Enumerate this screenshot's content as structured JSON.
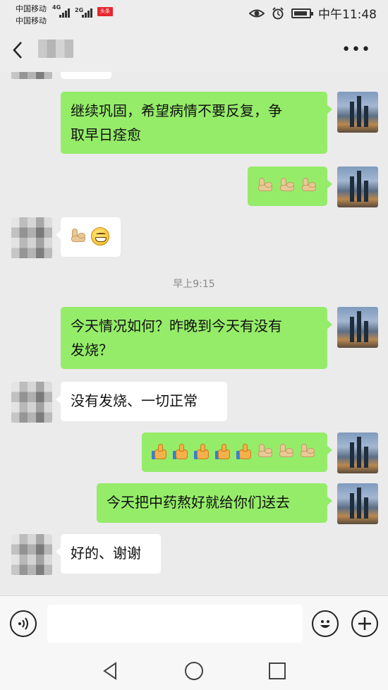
{
  "status_bar": {
    "carrier_1": "中国移动",
    "carrier_2": "中国移动",
    "network_1": "4G",
    "network_2": "2G",
    "news_badge": "头条",
    "time": "中午11:48",
    "battery_level": 0.9
  },
  "header": {
    "contact_name": "",
    "back_icon": "chevron-left-icon",
    "more_icon": "more-dots-icon"
  },
  "messages": [
    {
      "side": "out",
      "text": "继续巩固，希望病情不要反复，争取早日痊愈"
    },
    {
      "side": "out",
      "emoji": [
        "muscle",
        "muscle",
        "muscle"
      ]
    },
    {
      "side": "in",
      "emoji": [
        "muscle",
        "grin"
      ]
    },
    {
      "side": "out",
      "text": "今天情况如何？昨晚到今天有没有发烧？"
    },
    {
      "side": "in",
      "text": "没有发烧、一切正常"
    },
    {
      "side": "out",
      "emoji": [
        "thumbs-up",
        "thumbs-up",
        "thumbs-up",
        "thumbs-up",
        "thumbs-up",
        "muscle",
        "muscle",
        "muscle"
      ]
    },
    {
      "side": "out",
      "text": "今天把中药熬好就给你们送去"
    },
    {
      "side": "in",
      "text": "好的、谢谢"
    }
  ],
  "timestamp": "早上9:15",
  "msg_text": {
    "m0_line1": "继续巩固，希望病情不要反复，争",
    "m0_line2": "取早日痊愈",
    "m3_line1": "今天情况如何？昨晚到今天有没有",
    "m3_line2": "发烧？",
    "m4": "没有发烧、一切正常",
    "m6": "今天把中药熬好就给你们送去",
    "m7": "好的、谢谢"
  },
  "input_bar": {
    "voice_icon": "voice-icon",
    "emoji_icon": "smiley-icon",
    "plus_icon": "plus-icon",
    "input_value": ""
  },
  "nav": {
    "back_icon": "triangle-back-icon",
    "home_icon": "circle-home-icon",
    "recent_icon": "square-recent-icon"
  },
  "colors": {
    "outgoing_bubble": "#95ec69",
    "incoming_bubble": "#ffffff",
    "background": "#ebebeb"
  }
}
